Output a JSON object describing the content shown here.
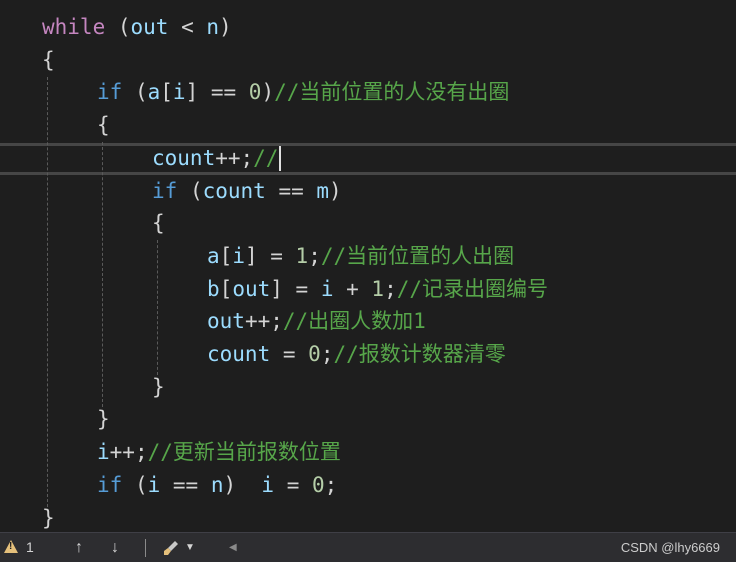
{
  "colors": {
    "keyword": "#c586c0",
    "control": "#569cd6",
    "variable": "#9cdcfe",
    "comment": "#57a64a",
    "number": "#b5cea8",
    "plain": "#d4d4d4",
    "background": "#1e1e1e"
  },
  "code": [
    {
      "indent": 1,
      "tokens": [
        {
          "t": "while",
          "c": "keyword"
        },
        {
          "t": " (",
          "c": "plain"
        },
        {
          "t": "out",
          "c": "variable"
        },
        {
          "t": " < ",
          "c": "plain"
        },
        {
          "t": "n",
          "c": "variable"
        },
        {
          "t": ")",
          "c": "plain"
        }
      ]
    },
    {
      "indent": 1,
      "tokens": [
        {
          "t": "{",
          "c": "plain"
        }
      ]
    },
    {
      "indent": 2,
      "tokens": [
        {
          "t": "if",
          "c": "control"
        },
        {
          "t": " (",
          "c": "plain"
        },
        {
          "t": "a",
          "c": "variable"
        },
        {
          "t": "[",
          "c": "plain"
        },
        {
          "t": "i",
          "c": "variable"
        },
        {
          "t": "] == ",
          "c": "plain"
        },
        {
          "t": "0",
          "c": "number"
        },
        {
          "t": ")",
          "c": "plain"
        },
        {
          "t": "//当前位置的人没有出圈",
          "c": "comment"
        }
      ]
    },
    {
      "indent": 2,
      "tokens": [
        {
          "t": "{",
          "c": "plain"
        }
      ]
    },
    {
      "indent": 3,
      "tokens": [
        {
          "t": "count",
          "c": "variable"
        },
        {
          "t": "++;",
          "c": "plain"
        },
        {
          "t": "//",
          "c": "comment"
        }
      ],
      "caret": true
    },
    {
      "indent": 3,
      "tokens": [
        {
          "t": "if",
          "c": "control"
        },
        {
          "t": " (",
          "c": "plain"
        },
        {
          "t": "count",
          "c": "variable"
        },
        {
          "t": " == ",
          "c": "plain"
        },
        {
          "t": "m",
          "c": "variable"
        },
        {
          "t": ")",
          "c": "plain"
        }
      ]
    },
    {
      "indent": 3,
      "tokens": [
        {
          "t": "{",
          "c": "plain"
        }
      ]
    },
    {
      "indent": 4,
      "tokens": [
        {
          "t": "a",
          "c": "variable"
        },
        {
          "t": "[",
          "c": "plain"
        },
        {
          "t": "i",
          "c": "variable"
        },
        {
          "t": "] = ",
          "c": "plain"
        },
        {
          "t": "1",
          "c": "number"
        },
        {
          "t": ";",
          "c": "plain"
        },
        {
          "t": "//当前位置的人出圈",
          "c": "comment"
        }
      ]
    },
    {
      "indent": 4,
      "tokens": [
        {
          "t": "b",
          "c": "variable"
        },
        {
          "t": "[",
          "c": "plain"
        },
        {
          "t": "out",
          "c": "variable"
        },
        {
          "t": "] = ",
          "c": "plain"
        },
        {
          "t": "i",
          "c": "variable"
        },
        {
          "t": " + ",
          "c": "plain"
        },
        {
          "t": "1",
          "c": "number"
        },
        {
          "t": ";",
          "c": "plain"
        },
        {
          "t": "//记录出圈编号",
          "c": "comment"
        }
      ]
    },
    {
      "indent": 4,
      "tokens": [
        {
          "t": "out",
          "c": "variable"
        },
        {
          "t": "++;",
          "c": "plain"
        },
        {
          "t": "//出圈人数加1",
          "c": "comment"
        }
      ]
    },
    {
      "indent": 4,
      "tokens": [
        {
          "t": "count",
          "c": "variable"
        },
        {
          "t": " = ",
          "c": "plain"
        },
        {
          "t": "0",
          "c": "number"
        },
        {
          "t": ";",
          "c": "plain"
        },
        {
          "t": "//报数计数器清零",
          "c": "comment"
        }
      ]
    },
    {
      "indent": 3,
      "tokens": [
        {
          "t": "}",
          "c": "plain"
        }
      ]
    },
    {
      "indent": 2,
      "tokens": [
        {
          "t": "}",
          "c": "plain"
        }
      ]
    },
    {
      "indent": 2,
      "tokens": [
        {
          "t": "i",
          "c": "variable"
        },
        {
          "t": "++;",
          "c": "plain"
        },
        {
          "t": "//更新当前报数位置",
          "c": "comment"
        }
      ]
    },
    {
      "indent": 2,
      "tokens": [
        {
          "t": "if",
          "c": "control"
        },
        {
          "t": " (",
          "c": "plain"
        },
        {
          "t": "i",
          "c": "variable"
        },
        {
          "t": " == ",
          "c": "plain"
        },
        {
          "t": "n",
          "c": "variable"
        },
        {
          "t": ")  ",
          "c": "plain"
        },
        {
          "t": "i",
          "c": "variable"
        },
        {
          "t": " = ",
          "c": "plain"
        },
        {
          "t": "0",
          "c": "number"
        },
        {
          "t": ";",
          "c": "plain"
        }
      ]
    },
    {
      "indent": 1,
      "tokens": [
        {
          "t": "}",
          "c": "plain"
        }
      ]
    }
  ],
  "status": {
    "warning_count": "1",
    "warning_icon": "warning-triangle-icon",
    "up_icon": "arrow-up-icon",
    "down_icon": "arrow-down-icon",
    "brush_icon": "brush-icon",
    "dropdown_icon": "caret-down-icon",
    "left_icon": "caret-left-icon",
    "watermark": "CSDN @lhy6669"
  }
}
